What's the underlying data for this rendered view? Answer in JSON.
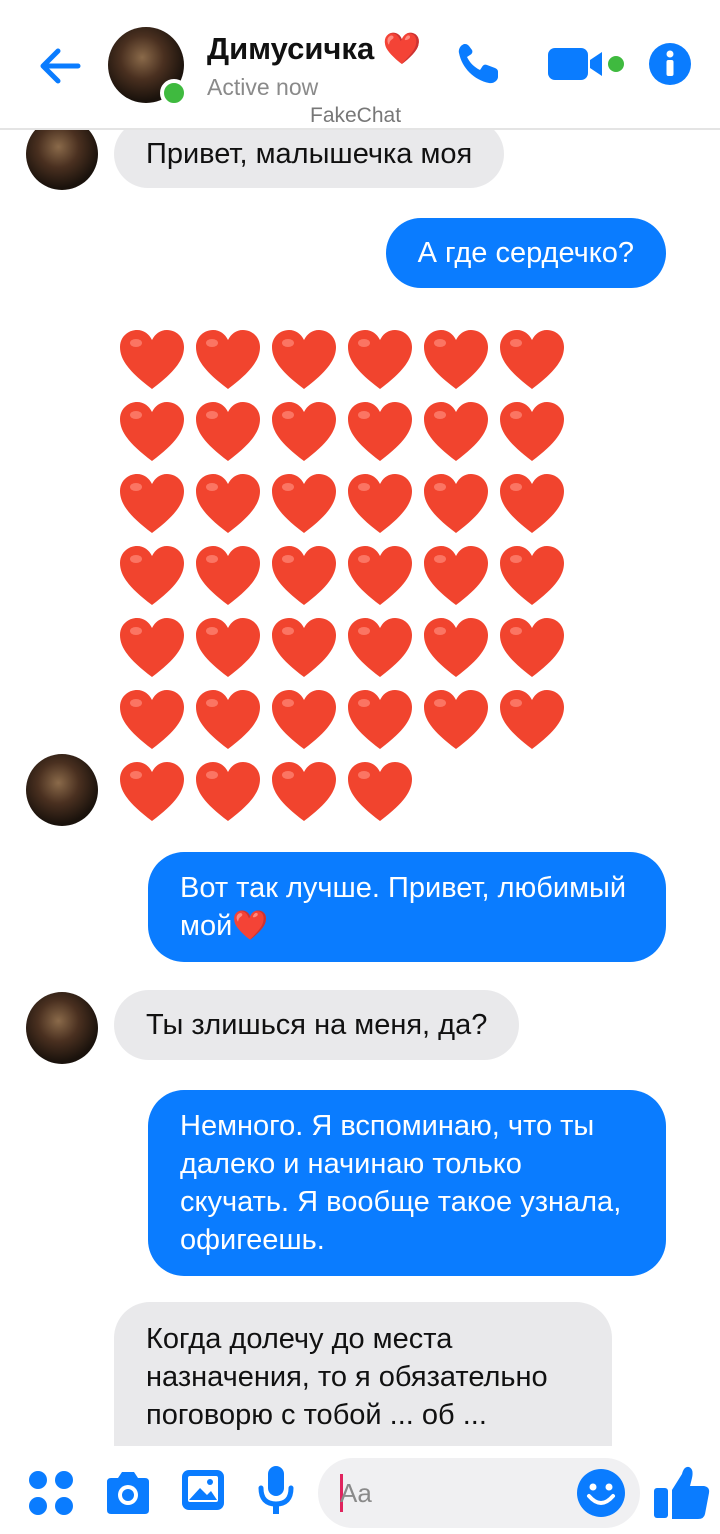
{
  "header": {
    "contact_name": "Димусичка ❤️",
    "status": "Active now",
    "watermark": "FakeChat"
  },
  "messages": [
    {
      "side": "in",
      "text": "Привет, малышечка моя"
    },
    {
      "side": "out",
      "text": "А где сердечко?"
    },
    {
      "side": "in",
      "type": "hearts",
      "count": 40
    },
    {
      "side": "out",
      "text": "Вот так лучше. Привет, любимый мой❤️"
    },
    {
      "side": "in",
      "text": "Ты злишься на меня, да?"
    },
    {
      "side": "out",
      "text": "Немного. Я вспоминаю, что ты далеко и начинаю только скучать. Я вообще такое узнала, офигеешь."
    },
    {
      "side": "in",
      "text": "Когда долечу до места назначения, то я обязательно поговорю с тобой ... об ..."
    }
  ],
  "composer": {
    "placeholder": "Aa"
  },
  "icons": {
    "back": "arrow-left-icon",
    "call": "phone-icon",
    "video": "video-camera-icon",
    "info": "info-icon",
    "menu": "four-dots-icon",
    "camera": "camera-icon",
    "gallery": "image-icon",
    "mic": "microphone-icon",
    "emoji": "smiley-icon",
    "like": "thumbs-up-icon"
  },
  "colors": {
    "accent": "#0a7cff",
    "incoming_bubble": "#e9e9eb",
    "online": "#3fba3f",
    "heart": "#f1442e"
  }
}
